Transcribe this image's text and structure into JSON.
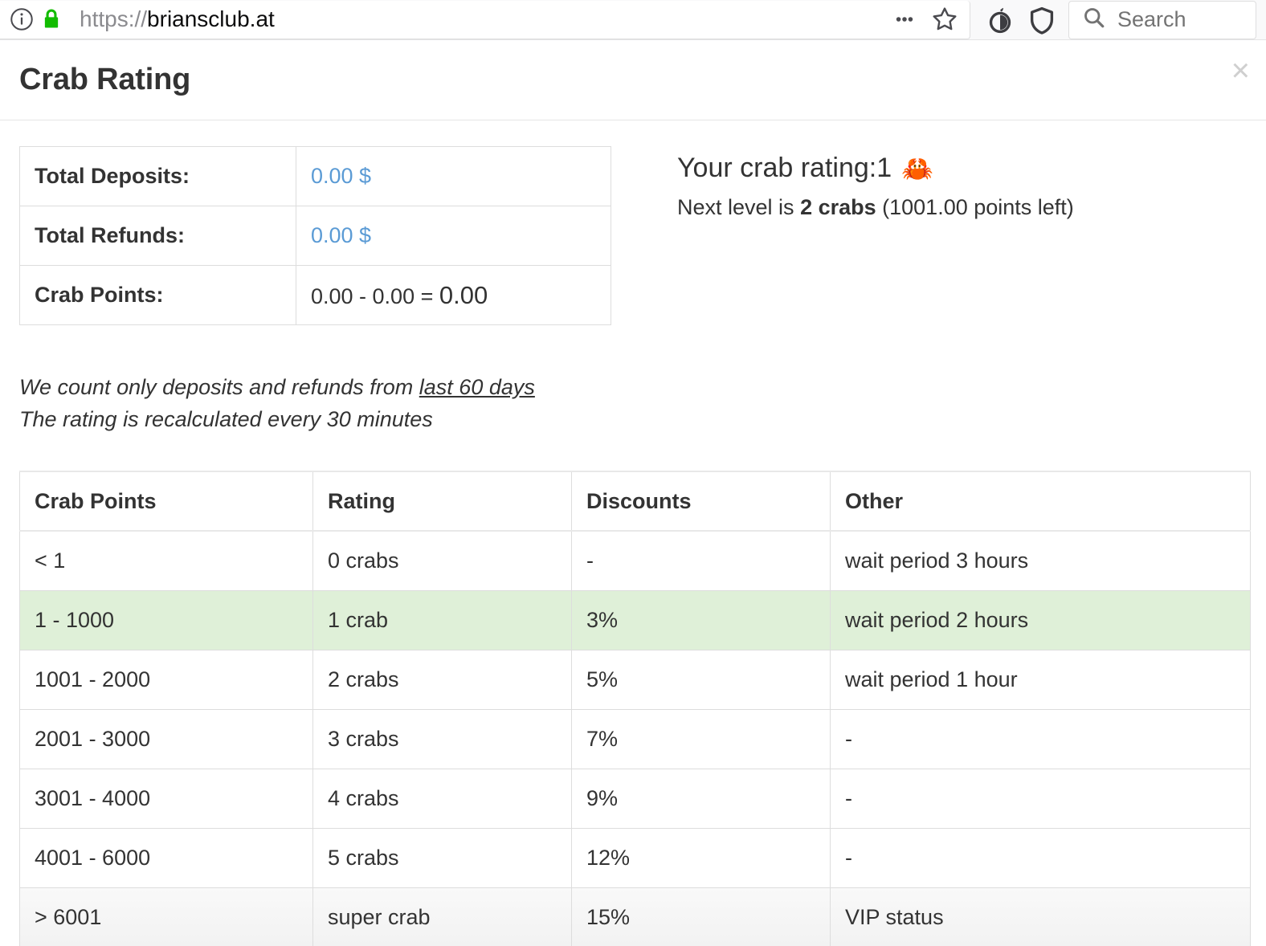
{
  "browser": {
    "url_scheme": "https://",
    "url_host": "briansclub.at",
    "info_icon": "info-circle-icon",
    "lock_icon": "padlock-icon",
    "ellipsis_label": "•••",
    "bookmark_icon": "star-icon",
    "tor_icon": "onion-icon",
    "shield_icon": "shield-icon",
    "search_placeholder": "Search",
    "search_icon": "magnifier-icon",
    "search_value": ""
  },
  "modal": {
    "title": "Crab Rating",
    "close_label": "×"
  },
  "summary": {
    "rows": [
      {
        "label": "Total Deposits:",
        "value": "0.00 $",
        "is_link": true
      },
      {
        "label": "Total Refunds:",
        "value": "0.00 $",
        "is_link": true
      }
    ],
    "crab_points_label": "Crab Points:",
    "crab_points_expr_prefix": "0.00 - 0.00 = ",
    "crab_points_expr_total": "0.00"
  },
  "rating": {
    "heading_prefix": "Your crab rating: ",
    "heading_value": "1",
    "crab_emoji": "🦀",
    "next_level_prefix": "Next level is ",
    "next_level_value": "2 crabs",
    "next_level_suffix": " (1001.00 points left)"
  },
  "notes": {
    "line1_prefix": "We count only deposits and refunds from ",
    "line1_underlined": "last 60 days",
    "line2": "The rating is recalculated every 30 minutes"
  },
  "ratings_table": {
    "headers": [
      "Crab Points",
      "Rating",
      "Discounts",
      "Other"
    ],
    "rows": [
      {
        "points": "< 1",
        "rating": "0 crabs",
        "discount": "-",
        "other": "wait period 3 hours",
        "state": ""
      },
      {
        "points": "1 - 1000",
        "rating": "1 crab",
        "discount": "3%",
        "other": "wait period 2 hours",
        "state": "highlight"
      },
      {
        "points": "1001 - 2000",
        "rating": "2 crabs",
        "discount": "5%",
        "other": "wait period 1 hour",
        "state": ""
      },
      {
        "points": "2001 - 3000",
        "rating": "3 crabs",
        "discount": "7%",
        "other": "-",
        "state": ""
      },
      {
        "points": "3001 - 4000",
        "rating": "4 crabs",
        "discount": "9%",
        "other": "-",
        "state": ""
      },
      {
        "points": "4001 - 6000",
        "rating": "5 crabs",
        "discount": "12%",
        "other": "-",
        "state": ""
      },
      {
        "points": "> 6001",
        "rating": "super crab",
        "discount": "15%",
        "other": "VIP status",
        "state": "hover"
      }
    ]
  },
  "colors": {
    "link": "#5b9bd5",
    "highlight_row": "#dff0d8",
    "lock_green": "#12bc00",
    "text": "#333333"
  }
}
